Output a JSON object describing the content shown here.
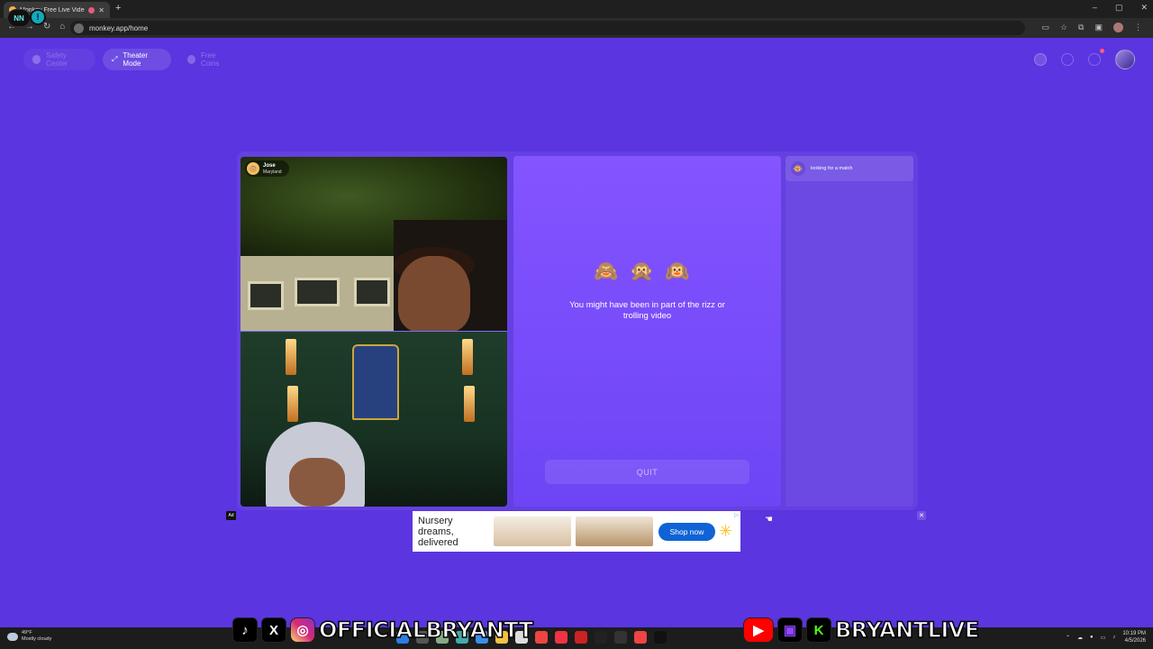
{
  "browser": {
    "tab_title": "Monkey Free Live Video Ch",
    "new_tab": "+",
    "url": "monkey.app/home",
    "window_controls": [
      "–",
      "▢",
      "✕"
    ]
  },
  "header": {
    "safety_center": "Safety Center",
    "theater_mode": "Theater Mode",
    "free_coins": "Free Coins"
  },
  "peer": {
    "name": "Jose",
    "location": "Maryland"
  },
  "match": {
    "emojis": "🙈🙊🙉",
    "message": "You might have been in part of the rizz or trolling video",
    "quit_label": "QUIT"
  },
  "chat": {
    "status": "looking for a match"
  },
  "ad": {
    "label": "Ad",
    "headline": "Nursery dreams, delivered",
    "cta": "Shop now",
    "close": "✕"
  },
  "overlay": {
    "handle_left": "OFFICIALBRYANTT",
    "handle_right": "BRYANTLIVE",
    "badge": "NN"
  },
  "taskbar": {
    "temp": "49°F",
    "condition": "Mostly cloudy",
    "time": "10:19 PM",
    "date": "4/5/2026"
  },
  "colors": {
    "background": "#5b35e0",
    "panel": "#7a4ef8",
    "shop_button": "#0f63d6"
  }
}
